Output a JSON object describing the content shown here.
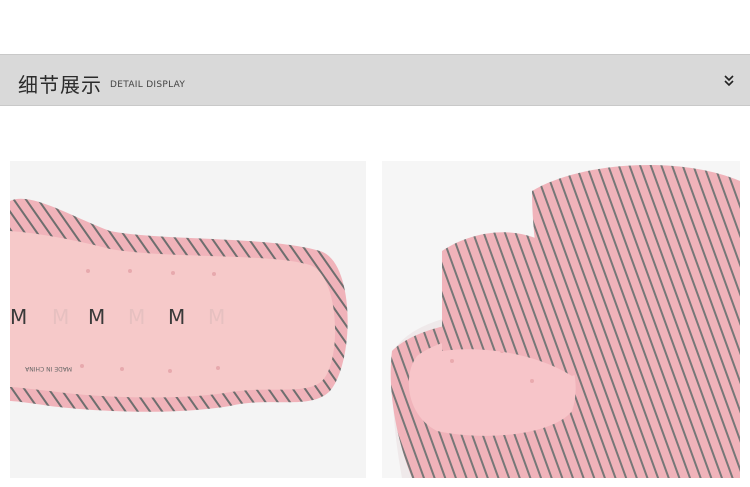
{
  "header": {
    "title_cn": "细节展示",
    "subtitle": "DETAIL DISPLAY",
    "icon": "chevron-double-down-icon"
  },
  "images": {
    "left": {
      "letters": [
        "M",
        "M",
        "M",
        "M",
        "M",
        "M"
      ],
      "label_line1": "MADE IN CHINA",
      "label_line2": "AHNIC NI EDAM"
    }
  },
  "colors": {
    "bar": "#d9d9d9",
    "slipper_pink": "#f1b6bd",
    "stripe": "#8a8a8a",
    "insole": "#f6c7c8"
  }
}
